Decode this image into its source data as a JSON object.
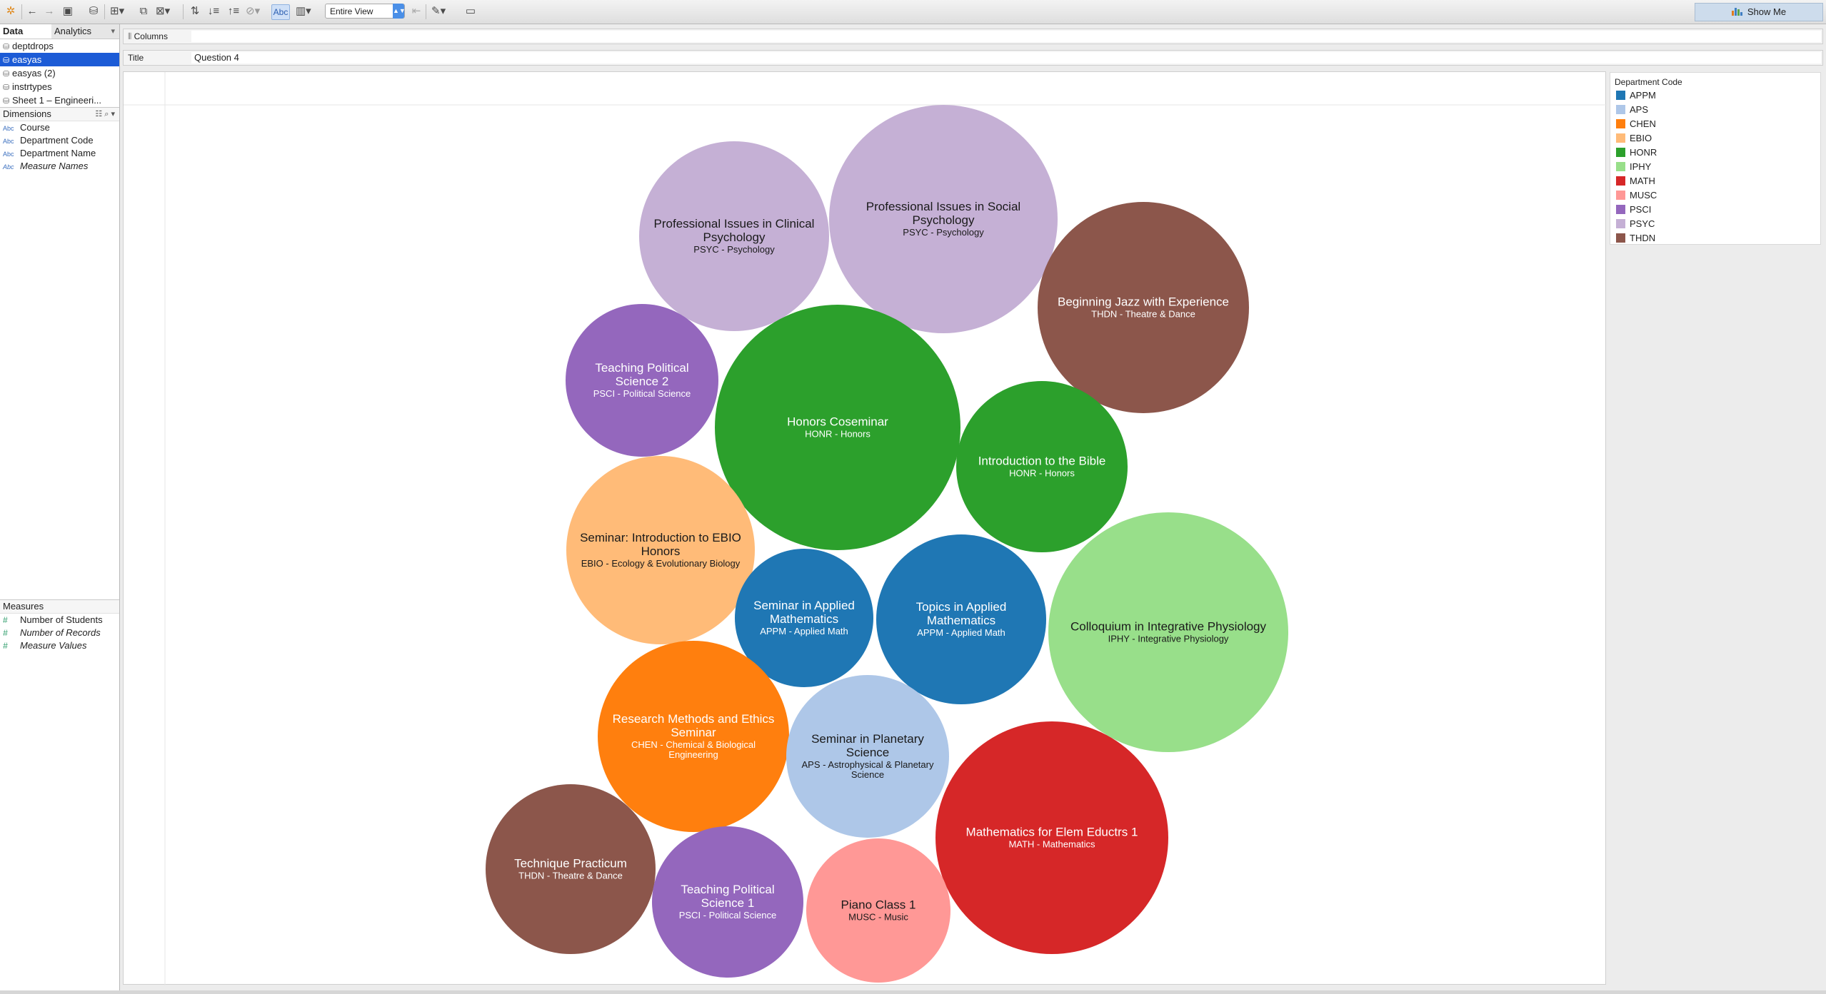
{
  "toolbar": {
    "view_select": "Entire View",
    "abc_label": "Abc",
    "show_me_label": "Show Me"
  },
  "left_pane": {
    "tab_data": "Data",
    "tab_analytics": "Analytics",
    "datasources": [
      "deptdrops",
      "easyas",
      "easyas (2)",
      "instrtypes",
      "Sheet 1 – Engineeri..."
    ],
    "selected_datasource": "easyas",
    "dimensions_title": "Dimensions",
    "dimensions": [
      "Course",
      "Department Code",
      "Department Name",
      "Measure Names"
    ],
    "measures_title": "Measures",
    "measures": [
      "Number of Students",
      "Number of Records",
      "Measure Values"
    ]
  },
  "shelves": {
    "columns_label": "Columns",
    "title_label": "Title",
    "title_value": "Question 4"
  },
  "legend": {
    "title": "Department Code",
    "items": [
      {
        "code": "APPM",
        "color": "#1f77b4"
      },
      {
        "code": "APS",
        "color": "#aec7e8"
      },
      {
        "code": "CHEN",
        "color": "#ff7f0e"
      },
      {
        "code": "EBIO",
        "color": "#ffbb78"
      },
      {
        "code": "HONR",
        "color": "#2ca02c"
      },
      {
        "code": "IPHY",
        "color": "#98df8a"
      },
      {
        "code": "MATH",
        "color": "#d62728"
      },
      {
        "code": "MUSC",
        "color": "#ff9896"
      },
      {
        "code": "PSCI",
        "color": "#9467bd"
      },
      {
        "code": "PSYC",
        "color": "#c5b0d5"
      },
      {
        "code": "THDN",
        "color": "#8c564b"
      }
    ]
  },
  "chart_data": {
    "type": "bubble",
    "bubbles": [
      {
        "course": "Professional Issues in Clinical Psychology",
        "dept_code": "PSYC",
        "dept_name": "Psychology",
        "label_lines": [
          "Professional Issues in Clinical",
          "Psychology"
        ],
        "sub_lines": [
          "PSYC - Psychology"
        ]
      },
      {
        "course": "Professional Issues in Social Psychology",
        "dept_code": "PSYC",
        "dept_name": "Psychology",
        "label_lines": [
          "Professional Issues in Social",
          "Psychology"
        ],
        "sub_lines": [
          "PSYC - Psychology"
        ]
      },
      {
        "course": "Beginning Jazz with Experience",
        "dept_code": "THDN",
        "dept_name": "Theatre & Dance",
        "label_lines": [
          "Beginning Jazz with Experience"
        ],
        "sub_lines": [
          "THDN - Theatre & Dance"
        ]
      },
      {
        "course": "Teaching Political Science 2",
        "dept_code": "PSCI",
        "dept_name": "Political Science",
        "label_lines": [
          "Teaching Political",
          "Science 2"
        ],
        "sub_lines": [
          "PSCI - Political Science"
        ]
      },
      {
        "course": "Honors Coseminar",
        "dept_code": "HONR",
        "dept_name": "Honors",
        "label_lines": [
          "Honors Coseminar"
        ],
        "sub_lines": [
          "HONR - Honors"
        ]
      },
      {
        "course": "Introduction to the Bible",
        "dept_code": "HONR",
        "dept_name": "Honors",
        "label_lines": [
          "Introduction to the Bible"
        ],
        "sub_lines": [
          "HONR - Honors"
        ]
      },
      {
        "course": "Seminar: Introduction to EBIO Honors",
        "dept_code": "EBIO",
        "dept_name": "Ecology & Evolutionary Biology",
        "label_lines": [
          "Seminar: Introduction to EBIO",
          "Honors"
        ],
        "sub_lines": [
          "EBIO - Ecology & Evolutionary Biology"
        ]
      },
      {
        "course": "Seminar in Applied Mathematics",
        "dept_code": "APPM",
        "dept_name": "Applied Math",
        "label_lines": [
          "Seminar in Applied",
          "Mathematics"
        ],
        "sub_lines": [
          "APPM - Applied Math"
        ]
      },
      {
        "course": "Topics in Applied Mathematics",
        "dept_code": "APPM",
        "dept_name": "Applied Math",
        "label_lines": [
          "Topics in Applied",
          "Mathematics"
        ],
        "sub_lines": [
          "APPM - Applied Math"
        ]
      },
      {
        "course": "Colloquium in Integrative Physiology",
        "dept_code": "IPHY",
        "dept_name": "Integrative Physiology",
        "label_lines": [
          "Colloquium in Integrative Physiology"
        ],
        "sub_lines": [
          "IPHY - Integrative Physiology"
        ]
      },
      {
        "course": "Research Methods and Ethics Seminar",
        "dept_code": "CHEN",
        "dept_name": "Chemical & Biological Engineering",
        "label_lines": [
          "Research Methods and Ethics",
          "Seminar"
        ],
        "sub_lines": [
          "CHEN - Chemical & Biological",
          "Engineering"
        ]
      },
      {
        "course": "Seminar in Planetary Science",
        "dept_code": "APS",
        "dept_name": "Astrophysical & Planetary Science",
        "label_lines": [
          "Seminar in Planetary",
          "Science"
        ],
        "sub_lines": [
          "APS - Astrophysical & Planetary",
          "Science"
        ]
      },
      {
        "course": "Mathematics for Elem Eductrs 1",
        "dept_code": "MATH",
        "dept_name": "Mathematics",
        "label_lines": [
          "Mathematics for Elem Eductrs 1"
        ],
        "sub_lines": [
          "MATH - Mathematics"
        ]
      },
      {
        "course": "Technique Practicum",
        "dept_code": "THDN",
        "dept_name": "Theatre & Dance",
        "label_lines": [
          "Technique Practicum"
        ],
        "sub_lines": [
          "THDN - Theatre & Dance"
        ]
      },
      {
        "course": "Teaching Political Science 1",
        "dept_code": "PSCI",
        "dept_name": "Political Science",
        "label_lines": [
          "Teaching Political",
          "Science 1"
        ],
        "sub_lines": [
          "PSCI - Political Science"
        ]
      },
      {
        "course": "Piano Class 1",
        "dept_code": "MUSC",
        "dept_name": "Music",
        "label_lines": [
          "Piano Class 1"
        ],
        "sub_lines": [
          "MUSC - Music"
        ]
      }
    ]
  }
}
